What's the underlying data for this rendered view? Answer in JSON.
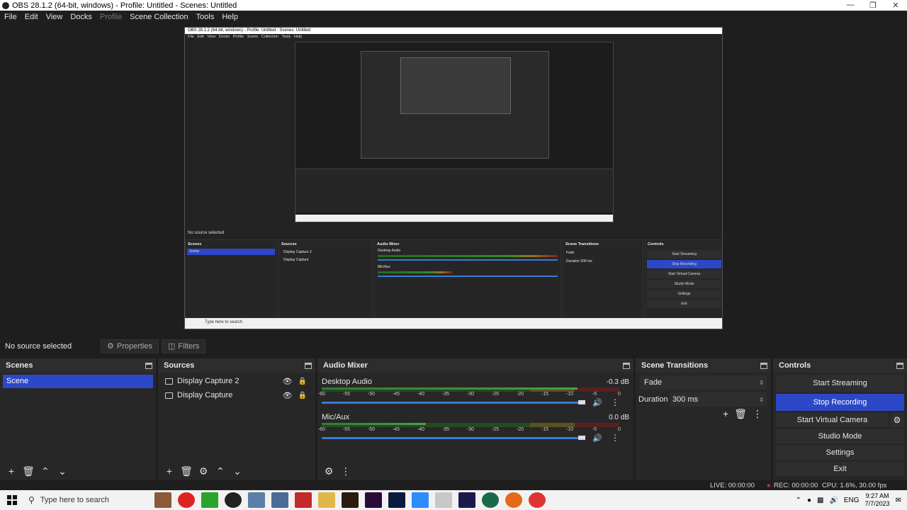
{
  "window": {
    "title": "OBS 28.1.2 (64-bit, windows) - Profile: Untitled - Scenes: Untitled"
  },
  "menu": [
    "File",
    "Edit",
    "View",
    "Docks",
    "Profile",
    "Scene Collection",
    "Tools",
    "Help"
  ],
  "preview_status": {
    "no_source": "No source selected",
    "properties": "Properties",
    "filters": "Filters"
  },
  "scenes": {
    "title": "Scenes",
    "items": [
      "Scene"
    ]
  },
  "sources": {
    "title": "Sources",
    "items": [
      "Display Capture 2",
      "Display Capture"
    ]
  },
  "mixer": {
    "title": "Audio Mixer",
    "ticks": [
      "-60",
      "-55",
      "-50",
      "-45",
      "-40",
      "-35",
      "-30",
      "-25",
      "-20",
      "-15",
      "-10",
      "-5",
      "0"
    ],
    "channels": [
      {
        "name": "Desktop Audio",
        "db": "-0.3 dB",
        "level": 0.86,
        "volume": 1.0
      },
      {
        "name": "Mic/Aux",
        "db": "0.0 dB",
        "level": 0.35,
        "volume": 1.0
      }
    ]
  },
  "transitions": {
    "title": "Scene Transitions",
    "type": "Fade",
    "duration_label": "Duration",
    "duration": "300 ms"
  },
  "controls": {
    "title": "Controls",
    "start_streaming": "Start Streaming",
    "stop_recording": "Stop Recording",
    "start_virtual_camera": "Start Virtual Camera",
    "studio_mode": "Studio Mode",
    "settings": "Settings",
    "exit": "Exit"
  },
  "status": {
    "live": "LIVE: 00:00:00",
    "rec": "REC: 00:00:00",
    "cpu": "CPU: 1.6%, 30.00 fps"
  },
  "taskbar": {
    "search_placeholder": "Type here to search",
    "lang": "ENG",
    "time": "9:27 AM",
    "date": "7/7/2023"
  },
  "colors": {
    "accent": "#2c48c8",
    "panel": "#272727",
    "bg": "#1f1e1f"
  },
  "icons": [
    "obs-icon",
    "minimize-icon",
    "restore-icon",
    "close-icon",
    "gear-icon",
    "filter-icon",
    "eye-icon",
    "lock-icon",
    "plus-icon",
    "trash-icon",
    "up-icon",
    "down-icon",
    "speaker-icon",
    "kebab-icon",
    "windows-start-icon",
    "search-icon"
  ]
}
